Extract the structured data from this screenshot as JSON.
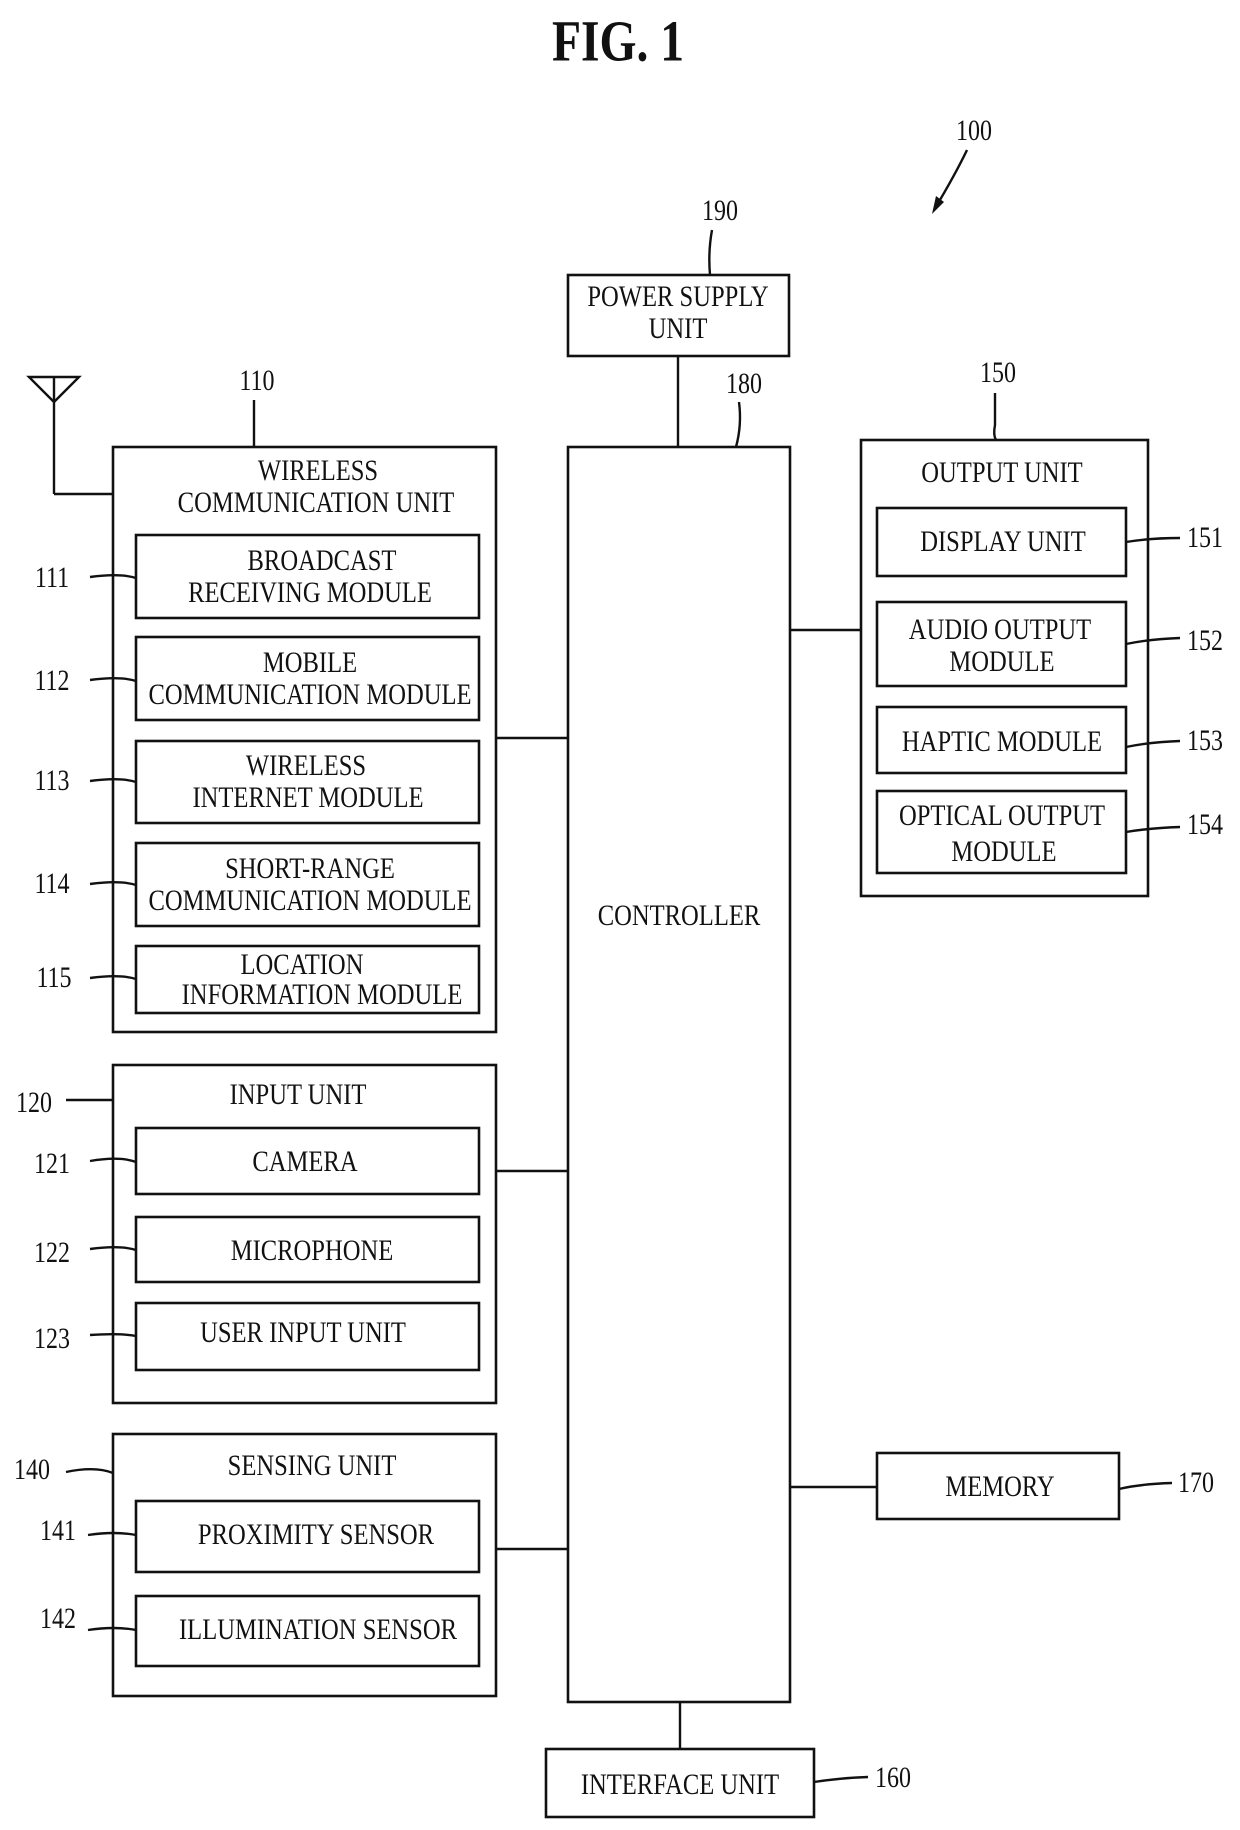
{
  "figure": {
    "title": "FIG. 1",
    "device_ref": "100"
  },
  "power_supply": {
    "ref": "190",
    "label_lines": [
      "POWER SUPPLY",
      "UNIT"
    ]
  },
  "controller": {
    "ref": "180",
    "label": "CONTROLLER"
  },
  "wireless_communication_unit": {
    "ref": "110",
    "label_lines": [
      "WIRELESS",
      "COMMUNICATION UNIT"
    ],
    "modules": [
      {
        "ref": "111",
        "label_lines": [
          "BROADCAST",
          "RECEIVING MODULE"
        ]
      },
      {
        "ref": "112",
        "label_lines": [
          "MOBILE",
          "COMMUNICATION MODULE"
        ]
      },
      {
        "ref": "113",
        "label_lines": [
          "WIRELESS",
          "INTERNET MODULE"
        ]
      },
      {
        "ref": "114",
        "label_lines": [
          "SHORT-RANGE",
          "COMMUNICATION MODULE"
        ]
      },
      {
        "ref": "115",
        "label_lines": [
          "LOCATION",
          "INFORMATION MODULE"
        ]
      }
    ]
  },
  "input_unit": {
    "ref": "120",
    "label": "INPUT UNIT",
    "modules": [
      {
        "ref": "121",
        "label": "CAMERA"
      },
      {
        "ref": "122",
        "label": "MICROPHONE"
      },
      {
        "ref": "123",
        "label": "USER INPUT UNIT"
      }
    ]
  },
  "sensing_unit": {
    "ref": "140",
    "label": "SENSING UNIT",
    "modules": [
      {
        "ref": "141",
        "label": "PROXIMITY SENSOR"
      },
      {
        "ref": "142",
        "label": "ILLUMINATION SENSOR"
      }
    ]
  },
  "output_unit": {
    "ref": "150",
    "label": "OUTPUT UNIT",
    "modules": [
      {
        "ref": "151",
        "label_lines": [
          "DISPLAY UNIT"
        ]
      },
      {
        "ref": "152",
        "label_lines": [
          "AUDIO OUTPUT",
          "MODULE"
        ]
      },
      {
        "ref": "153",
        "label_lines": [
          "HAPTIC MODULE"
        ]
      },
      {
        "ref": "154",
        "label_lines": [
          "OPTICAL OUTPUT",
          "MODULE"
        ]
      }
    ]
  },
  "memory": {
    "ref": "170",
    "label": "MEMORY"
  },
  "interface_unit": {
    "ref": "160",
    "label": "INTERFACE UNIT"
  }
}
